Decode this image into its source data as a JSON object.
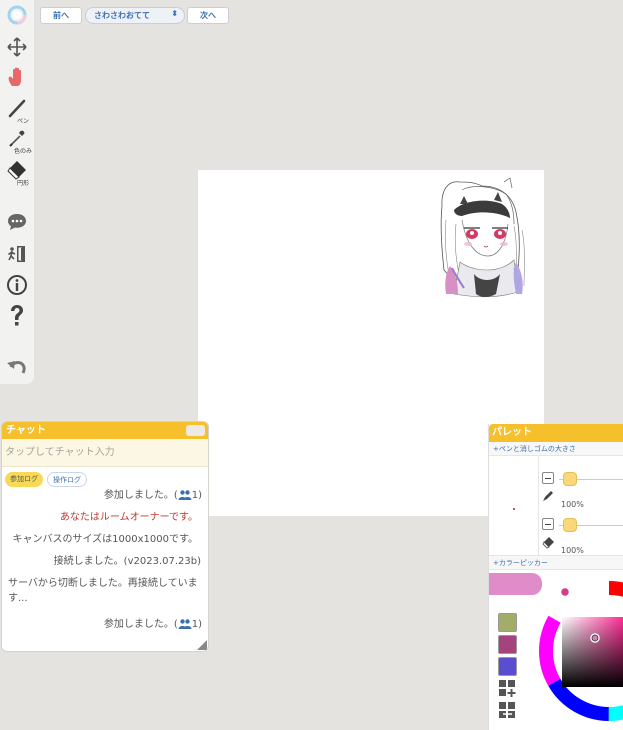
{
  "nav": {
    "prev_label": "前へ",
    "next_label": "次へ",
    "room_select": "さわさわおてて"
  },
  "toolbar": {
    "tools": [
      {
        "icon": "logo-icon"
      },
      {
        "icon": "move-icon"
      },
      {
        "icon": "hand-icon"
      },
      {
        "icon": "pen-icon",
        "label": "ペン"
      },
      {
        "icon": "eyedropper-icon",
        "label": "色のみ"
      },
      {
        "icon": "eraser-icon",
        "label": "円形"
      },
      {
        "icon": "chat-bubble-icon"
      },
      {
        "icon": "exit-icon"
      },
      {
        "icon": "info-icon"
      },
      {
        "icon": "help-icon"
      },
      {
        "icon": "undo-icon"
      }
    ]
  },
  "chat": {
    "title": "チャット",
    "input_placeholder": "タップしてチャット入力",
    "tabs": [
      "参加ログ",
      "操作ログ"
    ],
    "messages": [
      {
        "text": "参加しました。(",
        "count": "1)"
      },
      {
        "text": "あなたはルームオーナーです。"
      },
      {
        "text": "キャンバスのサイズは1000x1000です。"
      },
      {
        "text": "接続しました。(v2023.07.23b)"
      },
      {
        "text": "サーバから切断しました。再接続しています..."
      },
      {
        "text": "参加しました。(",
        "count": "1)"
      }
    ]
  },
  "palette": {
    "title": "パレット",
    "size_section": "+ペンと消しゴムの大きさ",
    "pen_size": "100%",
    "eraser_size": "100%",
    "picker_section": "+カラーピッカー",
    "current_color": "#e08cc8",
    "swatches": [
      "#a3ad68",
      "#a5447c",
      "#5a4dd0"
    ]
  },
  "colors": {
    "accent": "#f5c02c",
    "owner_message": "#c0392b",
    "link": "#3a6fb0"
  }
}
